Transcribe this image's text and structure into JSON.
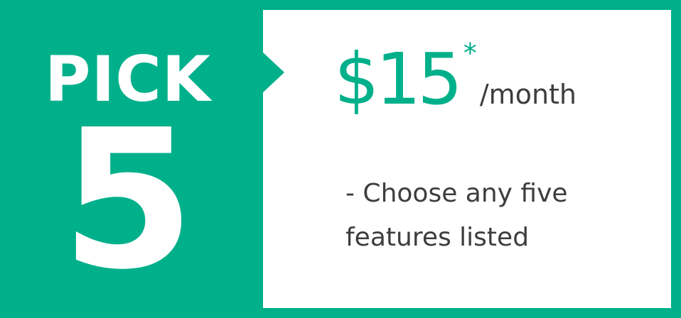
{
  "plan": {
    "pick_label": "PICK",
    "pick_number": "5",
    "price": "$15",
    "price_asterisk": "*",
    "price_period": "/month",
    "description": "- Choose any five features listed"
  },
  "colors": {
    "accent": "#00b08b",
    "panel": "#ffffff",
    "text_dark": "#3d3d3d"
  }
}
